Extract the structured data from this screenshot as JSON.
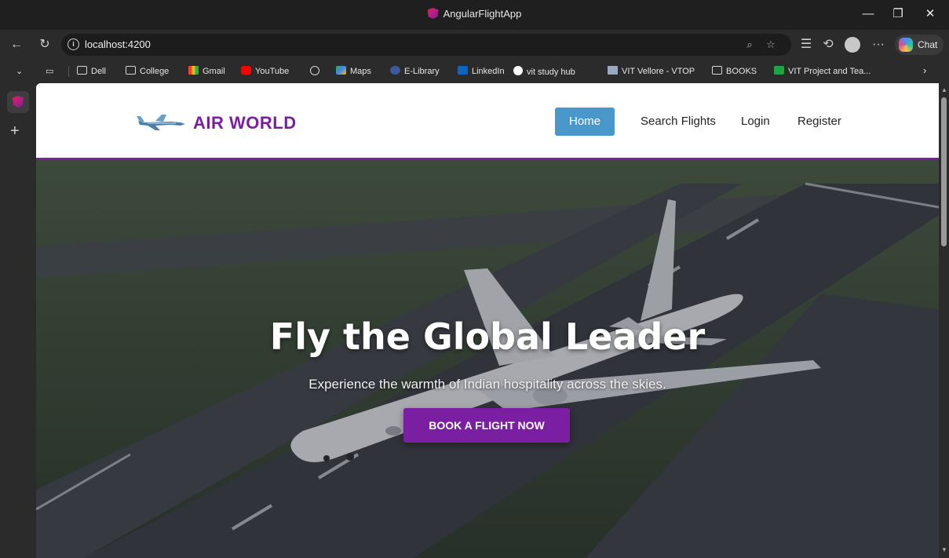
{
  "window": {
    "title": "AngularFlightApp",
    "minimize": "—",
    "restore": "❐",
    "close": "✕"
  },
  "browser": {
    "url": "localhost:4200",
    "chat_label": "Chat",
    "more": "···"
  },
  "bookmarks": [
    {
      "label": "Dell",
      "icon": "folder-icon"
    },
    {
      "label": "College",
      "icon": "folder-icon"
    },
    {
      "label": "Gmail",
      "icon": "gmail-icon"
    },
    {
      "label": "YouTube",
      "icon": "youtube-icon"
    },
    {
      "label": "",
      "icon": "globe-icon"
    },
    {
      "label": "Maps",
      "icon": "maps-icon"
    },
    {
      "label": "E-Library",
      "icon": "elibrary-icon"
    },
    {
      "label": "LinkedIn",
      "icon": "linkedin-icon"
    },
    {
      "label": "vit study hub",
      "icon": "vit-study-hub-icon"
    },
    {
      "label": "VIT Vellore - VTOP",
      "icon": "vtop-icon"
    },
    {
      "label": "BOOKS",
      "icon": "folder-icon"
    },
    {
      "label": "VIT Project and Tea...",
      "icon": "plus-green-icon"
    }
  ],
  "site": {
    "brand": "AIR WORLD",
    "nav": {
      "home": "Home",
      "search": "Search Flights",
      "login": "Login",
      "register": "Register"
    },
    "hero": {
      "title": "Fly the Global Leader",
      "subtitle": "Experience the warmth of Indian hospitality across the skies.",
      "cta": "BOOK A FLIGHT NOW"
    }
  },
  "colors": {
    "brand_purple": "#7b1fa2",
    "nav_active": "#4a98c9"
  }
}
